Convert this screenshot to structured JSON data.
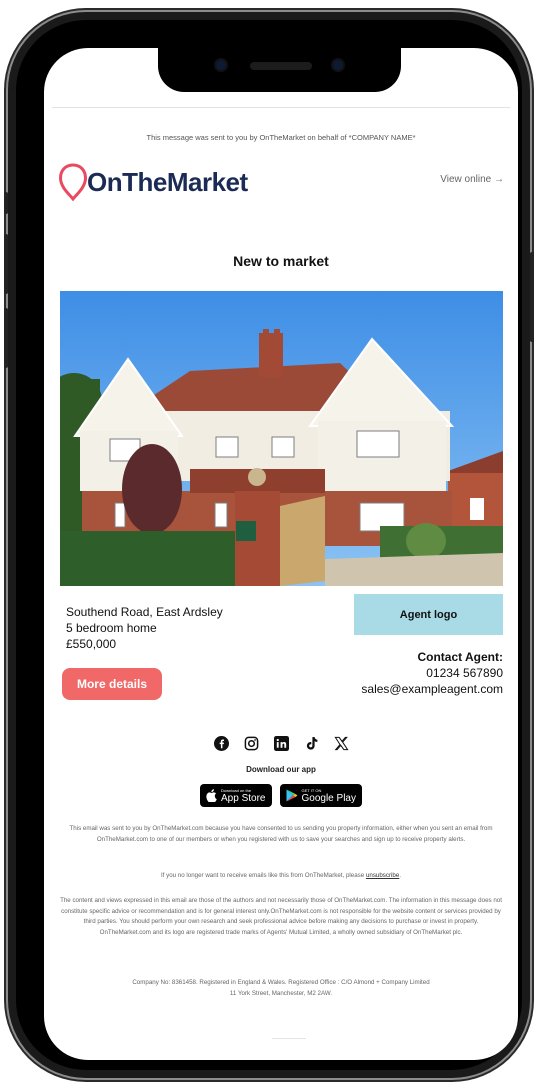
{
  "email": {
    "sent_by_line": "This message was sent to you by OnTheMarket on behalf of *COMPANY NAME*",
    "logo_text": "OnTheMarket",
    "view_online": "View online →",
    "headline": "New to market",
    "property": {
      "address": "Southend Road, East Ardsley",
      "type": "5 bedroom home",
      "price": "£550,000"
    },
    "agent_logo_label": "Agent logo",
    "contact": {
      "title": "Contact Agent:",
      "phone": "01234 567890",
      "email": "sales@exampleagent.com"
    },
    "more_details_label": "More details",
    "social_icons": [
      "facebook-icon",
      "instagram-icon",
      "linkedin-icon",
      "tiktok-icon",
      "x-icon"
    ],
    "download_app": "Download our app",
    "app_store": {
      "small": "Download on the",
      "big": "App Store"
    },
    "google_play": {
      "small": "GET IT ON",
      "big": "Google Play"
    },
    "footer": {
      "consent": "This email was sent to you by OnTheMarket.com because you have consented to us sending you property information, either when you sent an email from OnTheMarket.com to one of our members or when you registered with us to save your searches and sign up to receive property alerts.",
      "unsubscribe_prefix": "If you no longer want to receive emails like this from OnTheMarket, please",
      "unsubscribe_link": "unsubscribe",
      "unsubscribe_suffix": ".",
      "disclaimer": "The content and views expressed in this email are those of the authors and not necessarily those of OnTheMarket.com. The information in this message does not constitute specific advice or recommendation and is for general interest only.OnTheMarket.com is not responsible for the website content or services provided by third parties. You should perform your own research and seek professional advice before making any decisions to purchase or invest in property. OnTheMarket.com and its logo are registered trade marks of Agents' Mutual Limited, a wholly owned subsidiary of OnTheMarket plc.",
      "company_line1": "Company No: 8361458. Registered in England & Wales. Registered Office : C/O Almond + Company Limited",
      "company_line2": "11 York Street, Manchester, M2 2AW."
    }
  },
  "colors": {
    "brand_navy": "#1c2b55",
    "brand_red": "#e84a5f",
    "button": "#f06868",
    "agent_logo_bg": "#a9dbe6"
  }
}
